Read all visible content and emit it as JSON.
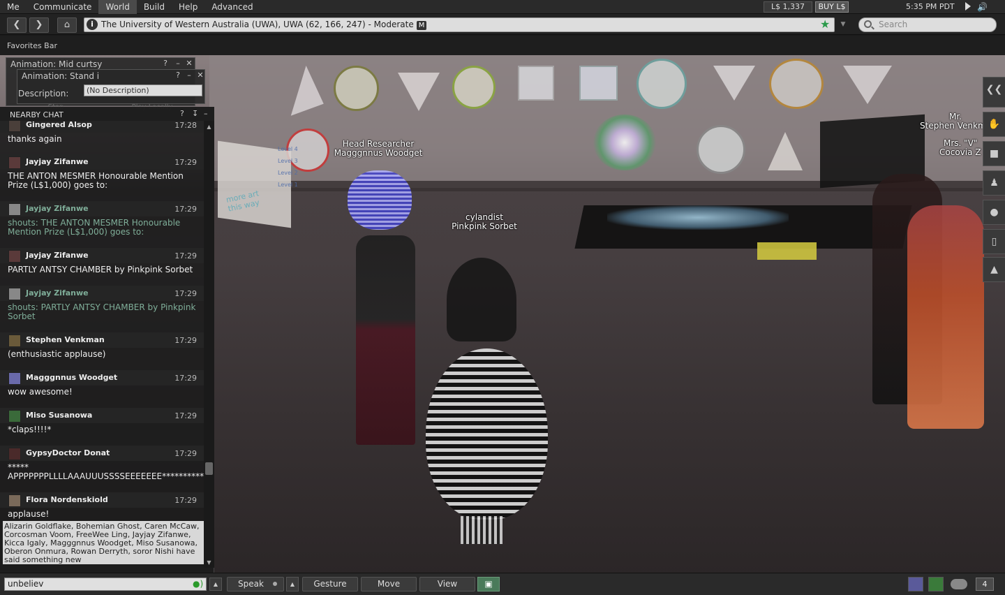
{
  "menubar": {
    "items": [
      "Me",
      "Communicate",
      "World",
      "Build",
      "Help",
      "Advanced"
    ],
    "balance": "L$ 1,337",
    "buy_label": "BUY L$",
    "clock": "5:35 PM PDT"
  },
  "navbar": {
    "location": "The University of Western Australia (UWA), UWA (62, 166, 247) - Moderate",
    "maturity_badge": "M",
    "search_placeholder": "Search"
  },
  "favorites_bar": {
    "label": "Favorites Bar"
  },
  "world": {
    "avatar_tags": [
      {
        "title": "Head Researcher",
        "name": "Magggnnus Woodget"
      },
      {
        "title": "cylandist",
        "name": "Pinkpink Sorbet"
      },
      {
        "title": "Mr.",
        "name": "Stephen Venkm"
      },
      {
        "title": "Mrs. \"V\"",
        "name": "Cocovia Z"
      }
    ],
    "signs": [
      "more art",
      "this way"
    ],
    "levels": [
      "Level 4",
      "Level 3",
      "Level 2",
      "Level 1"
    ]
  },
  "floaters": {
    "back_title": "Animation: Mid curtsy",
    "front_title": "Animation: Stand i",
    "description_label": "Description:",
    "description_value": "(No Description)",
    "stop_label": "Stop",
    "play_locally_label": "Play Locally"
  },
  "chat": {
    "title": "NEARBY CHAT",
    "messages": [
      {
        "name": "Gingered Alsop",
        "time": "17:28",
        "text": "thanks again",
        "shout": false
      },
      {
        "name": "Jayjay Zifanwe",
        "time": "17:29",
        "text": "THE ANTON MESMER Honourable Mention Prize (L$1,000) goes to:",
        "shout": false
      },
      {
        "name": "Jayjay Zifanwe",
        "time": "17:29",
        "text": "shouts: THE ANTON MESMER Honourable Mention Prize (L$1,000) goes to:",
        "shout": true
      },
      {
        "name": "Jayjay Zifanwe",
        "time": "17:29",
        "text": "PARTLY ANTSY CHAMBER by Pinkpink Sorbet",
        "shout": false
      },
      {
        "name": "Jayjay Zifanwe",
        "time": "17:29",
        "text": "shouts: PARTLY ANTSY CHAMBER by Pinkpink Sorbet",
        "shout": true
      },
      {
        "name": "Stephen Venkman",
        "time": "17:29",
        "text": "(enthusiastic applause)",
        "shout": false
      },
      {
        "name": "Magggnnus Woodget",
        "time": "17:29",
        "text": "wow awesome!",
        "shout": false
      },
      {
        "name": "Miso Susanowa",
        "time": "17:29",
        "text": "*claps!!!!*",
        "shout": false
      },
      {
        "name": "GypsyDoctor Donat",
        "time": "17:29",
        "text": "*****\nAPPPPPPPLLLLAAAUUUSSSSEEEEEEE**********",
        "shout": false
      },
      {
        "name": "Flora Nordenskiold",
        "time": "17:29",
        "text": "applause!",
        "shout": false
      }
    ],
    "new_messages_notice": "Alizarin Goldflake, Bohemian Ghost, Caren McCaw, Corcosman Voom, FreeWee Ling, Jayjay Zifanwe, Kicca Igaly, Magggnnus Woodget, Miso Susanowa, Oberon Onmura, Rowan Derryth, soror Nishi have said something new"
  },
  "bottombar": {
    "chat_input_value": "unbeliev",
    "speak_label": "Speak",
    "gesture_label": "Gesture",
    "move_label": "Move",
    "view_label": "View",
    "notification_count": "4"
  },
  "colors": {
    "shout_text": "#7fae99",
    "favorite_star": "#2a9a4a"
  }
}
